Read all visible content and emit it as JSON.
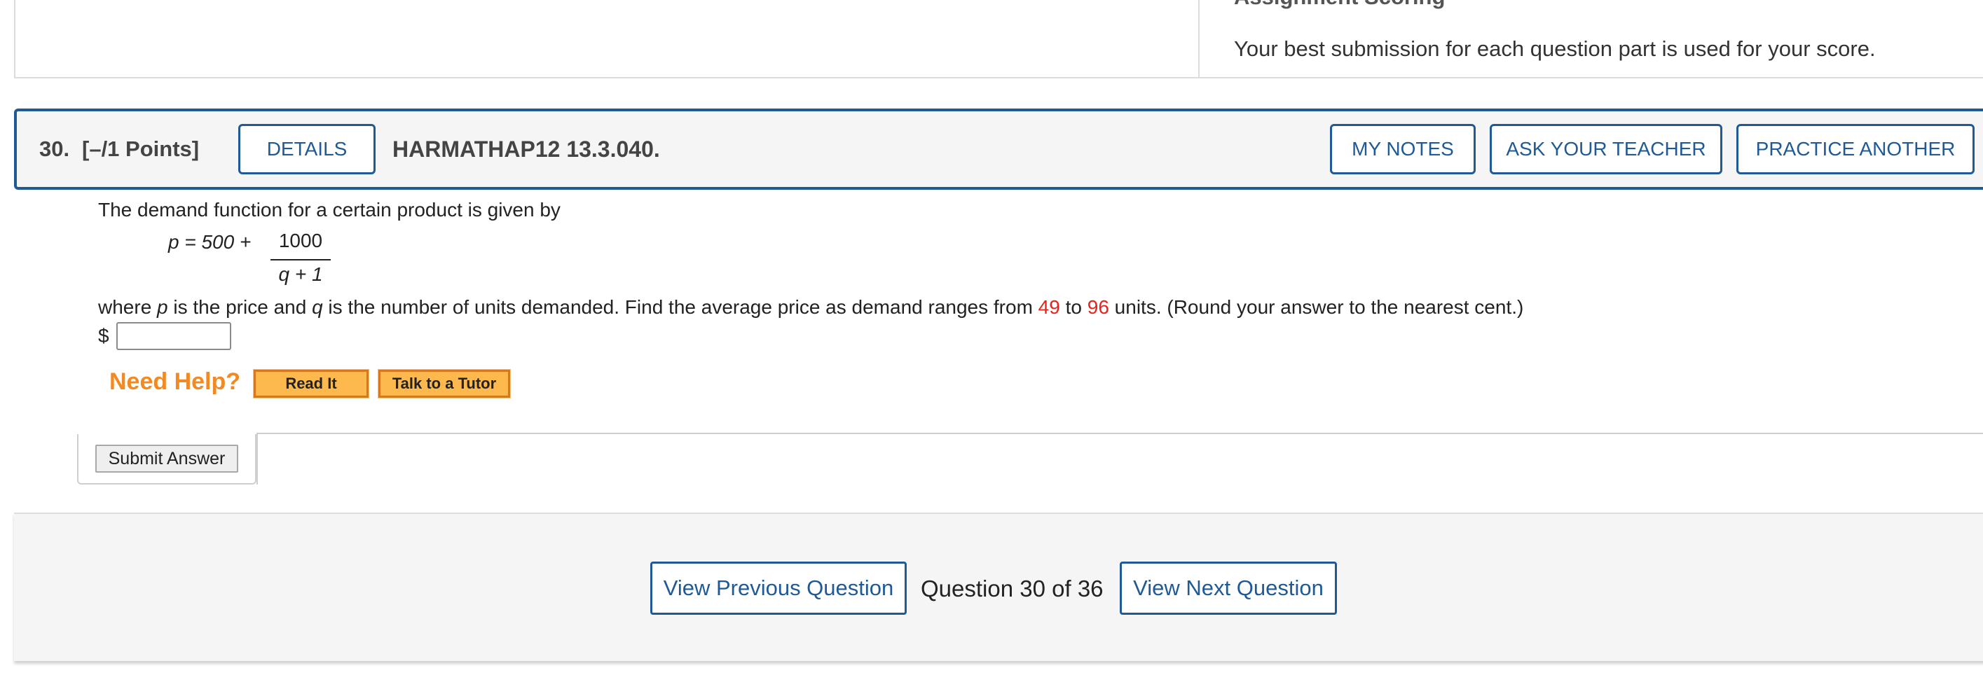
{
  "scoring": {
    "heading": "Assignment Scoring",
    "text": "Your best submission for each question part is used for your score."
  },
  "question": {
    "number": "30.",
    "points": "[–/1 Points]",
    "details_label": "DETAILS",
    "code": "HARMATHAP12 13.3.040.",
    "my_notes_label": "MY NOTES",
    "ask_teacher_label": "ASK YOUR TEACHER",
    "practice_another_label": "PRACTICE ANOTHER"
  },
  "body": {
    "prompt": "The demand function for a certain product is given by",
    "formula": {
      "lhs": "p = 500 +",
      "numerator": "1000",
      "denominator": "q + 1"
    },
    "where_part1": "where ",
    "var_p": "p",
    "where_part2": " is the price and ",
    "var_q": "q",
    "where_part3": " is the number of units demanded. Find the average price as demand ranges from ",
    "low_value": "49",
    "to_word": " to ",
    "high_value": "96",
    "where_part4": " units. (Round your answer to the nearest cent.)",
    "currency": "$",
    "answer_value": ""
  },
  "help": {
    "label": "Need Help?",
    "read_it": "Read It",
    "talk_tutor": "Talk to a Tutor"
  },
  "submit_label": "Submit Answer",
  "navigation": {
    "previous_label": "View Previous Question",
    "status": "Question 30 of 36",
    "next_label": "View Next Question"
  },
  "colors": {
    "accent": "#1f5a96",
    "highlight_number": "#e8231c",
    "help_orange": "#f28a23"
  }
}
